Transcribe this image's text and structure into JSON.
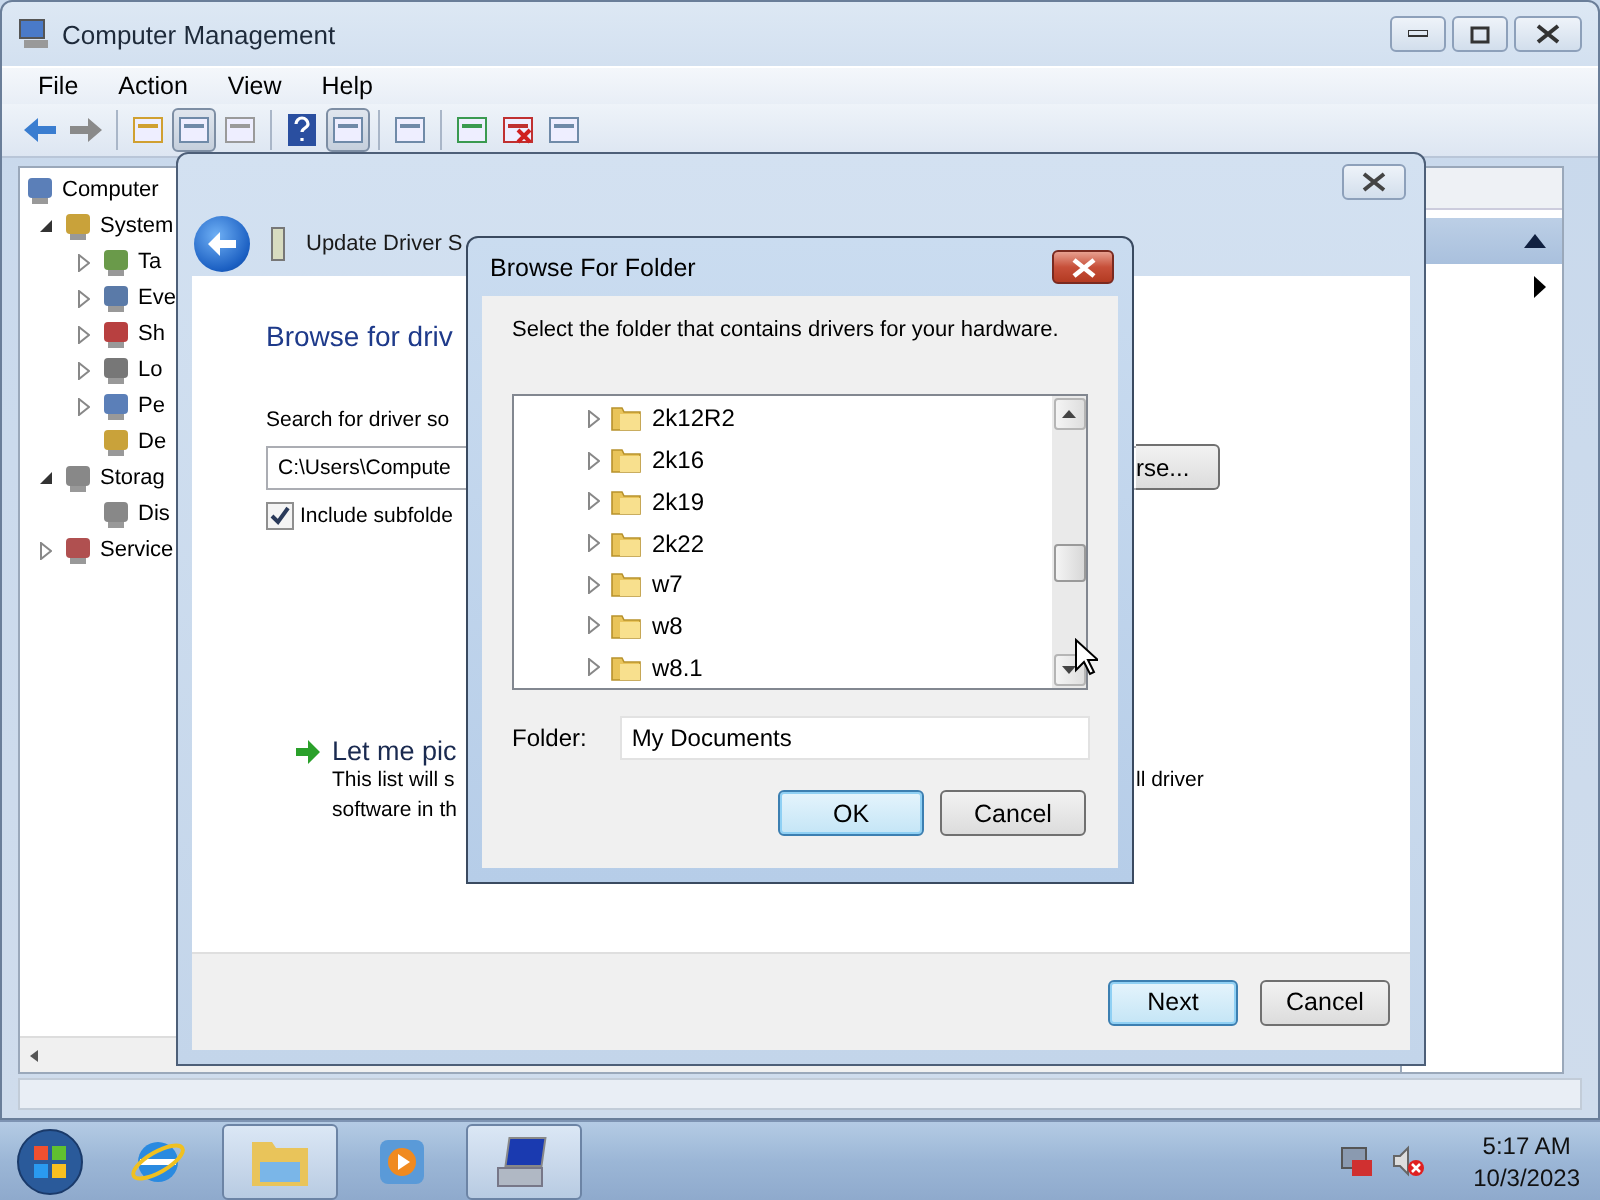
{
  "main_window": {
    "title": "Computer Management",
    "menu": [
      "File",
      "Action",
      "View",
      "Help"
    ],
    "toolbar": [
      {
        "pressed": false
      },
      {
        "pressed": false
      },
      {
        "pressed": false
      },
      {
        "pressed": true
      },
      {
        "pressed": false
      },
      {
        "pressed": false
      },
      {
        "pressed": true
      },
      {
        "pressed": false
      },
      {
        "pressed": false
      },
      {
        "pressed": false
      },
      {
        "pressed": false
      }
    ],
    "tree": [
      {
        "label": "Computer",
        "children": [
          {
            "label": "System",
            "expanded": true,
            "children": [
              {
                "label": "Ta",
                "expanded": false
              },
              {
                "label": "Eve",
                "expanded": false
              },
              {
                "label": "Sh",
                "expanded": false
              },
              {
                "label": "Lo",
                "expanded": false
              },
              {
                "label": "Pe",
                "expanded": false
              },
              {
                "label": "De"
              }
            ]
          },
          {
            "label": "Storag",
            "expanded": true,
            "children": [
              {
                "label": "Dis"
              }
            ]
          },
          {
            "label": "Service",
            "expanded": false
          }
        ]
      }
    ]
  },
  "update_dialog": {
    "title": "Update Driver S",
    "heading": "Browse for driv",
    "search_label": "Search for driver so",
    "path": "C:\\Users\\Compute",
    "browse_button": "rse...",
    "include_subfolders": {
      "label": "Include subfolde",
      "checked": true
    },
    "pick_link": "Let me pic",
    "pick_desc_line1": "This list will s",
    "pick_desc_line1_tail": "ll driver",
    "pick_desc_line2": "software in th",
    "buttons": [
      {
        "label": "Next",
        "default": true
      },
      {
        "label": "Cancel",
        "default": false
      }
    ]
  },
  "browse_dialog": {
    "title": "Browse For Folder",
    "prompt": "Select the folder that contains drivers for your hardware.",
    "folders": [
      {
        "label": "2k12R2",
        "expanded": false
      },
      {
        "label": "2k16",
        "expanded": false
      },
      {
        "label": "2k19",
        "expanded": false
      },
      {
        "label": "2k22",
        "expanded": false
      },
      {
        "label": "w7",
        "expanded": false
      },
      {
        "label": "w8",
        "expanded": false
      },
      {
        "label": "w8.1",
        "expanded": false
      }
    ],
    "folder_label": "Folder:",
    "folder_value": "My Documents",
    "buttons": [
      {
        "label": "OK",
        "default": true
      },
      {
        "label": "Cancel",
        "default": false
      }
    ]
  },
  "taskbar": {
    "apps": [
      {
        "running": false
      },
      {
        "running": true
      },
      {
        "running": false
      },
      {
        "running": true
      }
    ],
    "time": "5:17 AM",
    "date": "10/3/2023"
  }
}
